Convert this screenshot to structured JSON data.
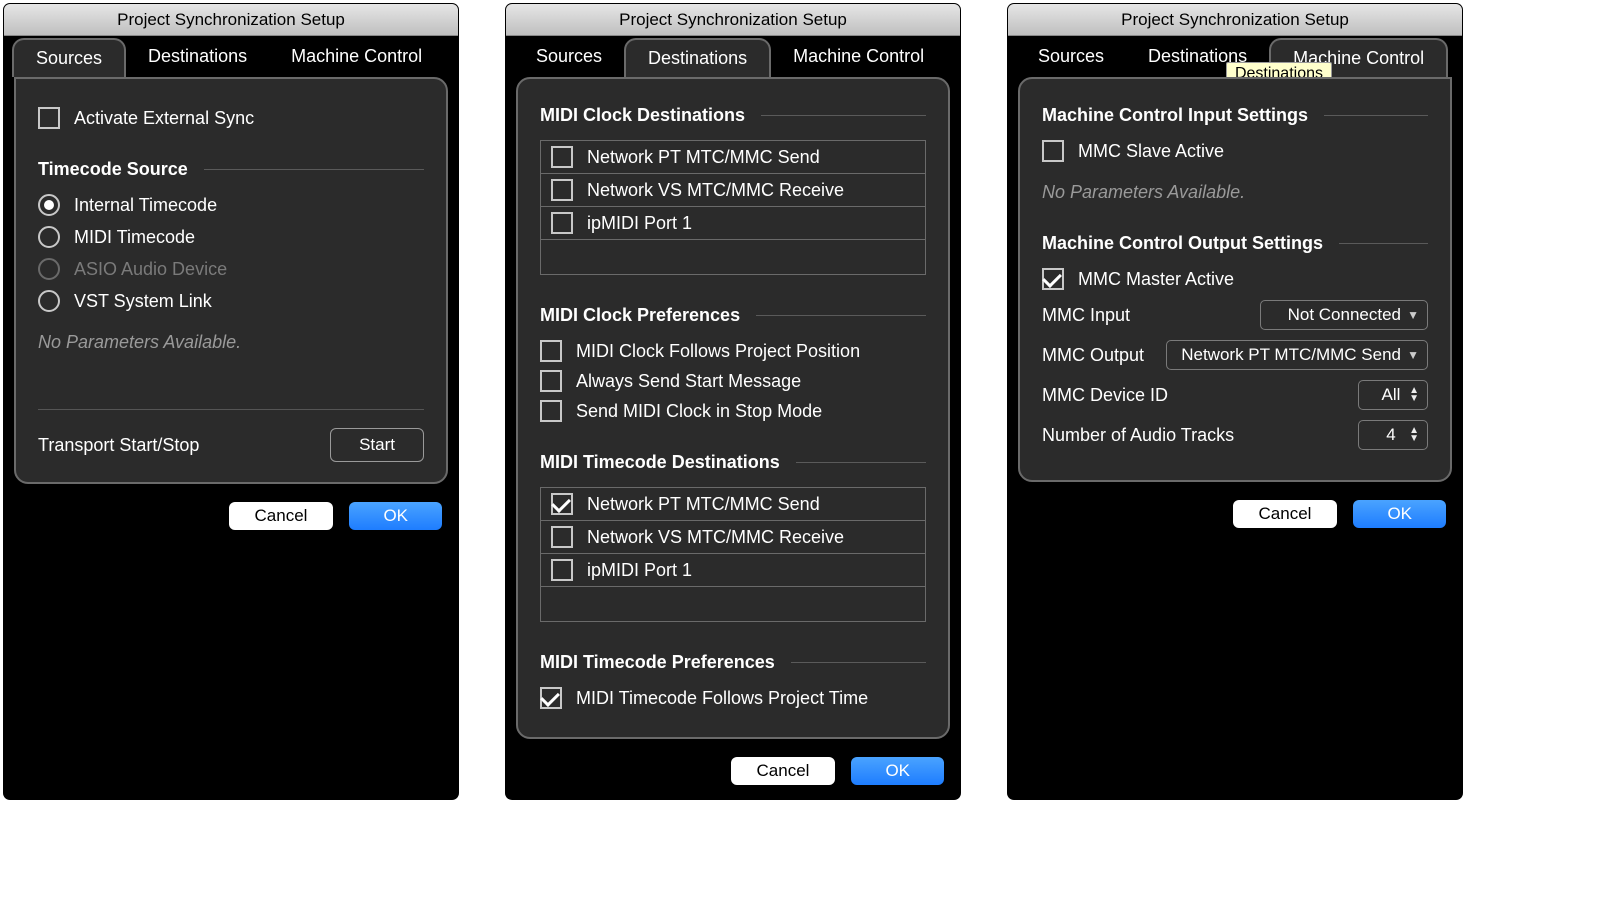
{
  "window_title": "Project Synchronization Setup",
  "tabs": {
    "sources": "Sources",
    "destinations": "Destinations",
    "machine": "Machine Control"
  },
  "buttons": {
    "cancel": "Cancel",
    "ok": "OK",
    "start": "Start"
  },
  "sources_panel": {
    "activate_sync": "Activate External Sync",
    "activate_sync_checked": false,
    "section_timecode": "Timecode Source",
    "radios": {
      "internal": "Internal Timecode",
      "midi": "MIDI Timecode",
      "asio": "ASIO Audio Device",
      "vst": "VST System Link"
    },
    "selected_radio": "internal",
    "note": "No Parameters Available.",
    "transport_label": "Transport Start/Stop"
  },
  "dest_panel": {
    "section_clock_dest": "MIDI Clock Destinations",
    "clock_dest_items": [
      {
        "label": "Network PT MTC/MMC Send",
        "checked": false
      },
      {
        "label": "Network VS MTC/MMC Receive",
        "checked": false
      },
      {
        "label": "ipMIDI Port 1",
        "checked": false
      }
    ],
    "section_clock_prefs": "MIDI Clock Preferences",
    "clock_prefs": [
      {
        "label": "MIDI Clock Follows Project Position",
        "checked": false
      },
      {
        "label": "Always Send Start Message",
        "checked": false
      },
      {
        "label": "Send MIDI Clock in Stop Mode",
        "checked": false
      }
    ],
    "section_tc_dest": "MIDI Timecode Destinations",
    "tc_dest_items": [
      {
        "label": "Network PT MTC/MMC Send",
        "checked": true
      },
      {
        "label": "Network VS MTC/MMC Receive",
        "checked": false
      },
      {
        "label": "ipMIDI Port 1",
        "checked": false
      }
    ],
    "section_tc_prefs": "MIDI Timecode Preferences",
    "tc_follows": {
      "label": "MIDI Timecode Follows Project Time",
      "checked": true
    }
  },
  "mc_panel": {
    "tooltip": "Destinations",
    "section_in": "Machine Control Input Settings",
    "mmc_slave": {
      "label": "MMC Slave Active",
      "checked": false
    },
    "note": "No Parameters Available.",
    "section_out": "Machine Control Output Settings",
    "mmc_master": {
      "label": "MMC Master Active",
      "checked": true
    },
    "fields": {
      "mmc_input_label": "MMC Input",
      "mmc_input_value": "Not Connected",
      "mmc_output_label": "MMC Output",
      "mmc_output_value": "Network PT MTC/MMC Send",
      "device_id_label": "MMC Device ID",
      "device_id_value": "All",
      "num_tracks_label": "Number of Audio Tracks",
      "num_tracks_value": "4"
    }
  }
}
